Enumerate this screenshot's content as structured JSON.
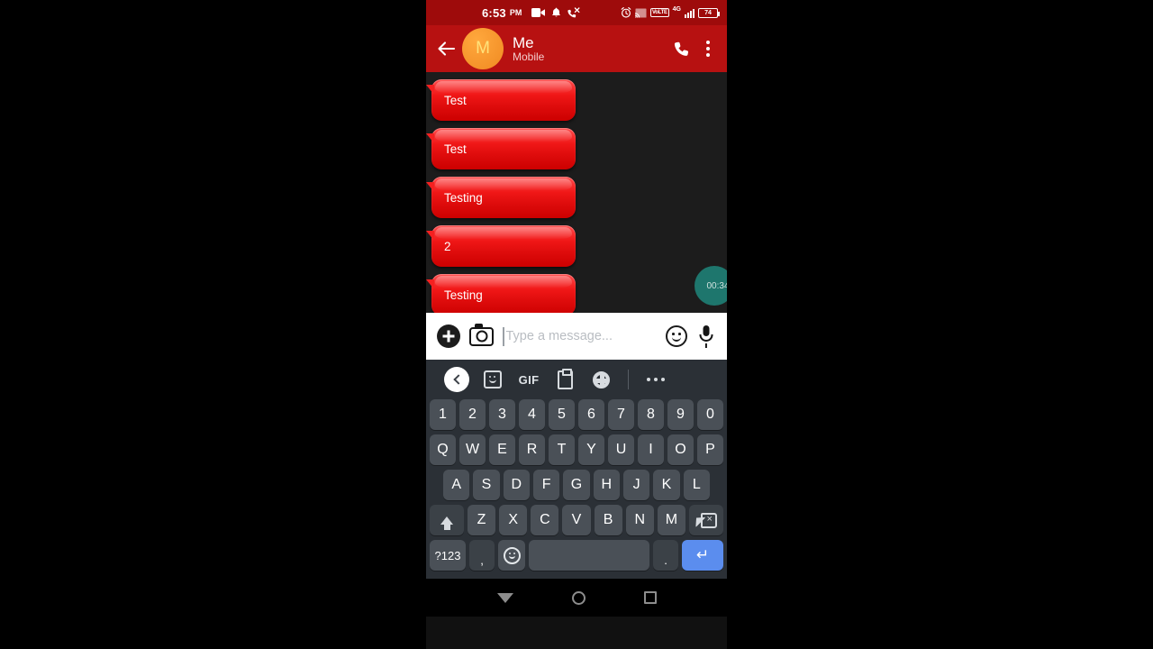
{
  "statusbar": {
    "time": "6:53",
    "ampm": "PM",
    "icons_left": [
      "video-recorder-icon",
      "bell-icon",
      "missed-call-icon"
    ],
    "alarm": "alarm-icon",
    "cast": "cast-icon",
    "volte": "VoLTE",
    "network": "4G",
    "battery_level": "74",
    "bg_color": "#9e0b0b"
  },
  "appbar": {
    "back_label": "back-arrow",
    "avatar_letter": "M",
    "contact_name": "Me",
    "contact_subtitle": "Mobile",
    "call_label": "call",
    "overflow_label": "more-options",
    "bg_color": "#b71111",
    "avatar_color": "#f08a22"
  },
  "chat": {
    "bg_color": "#1c1c1c",
    "bubble_color": "#e00d0d",
    "messages": [
      {
        "text": "Test"
      },
      {
        "text": "Test"
      },
      {
        "text": "Testing"
      },
      {
        "text": "2"
      },
      {
        "text": "Testing"
      }
    ],
    "recorder_timer": "00:34",
    "recorder_color": "#1f7e74"
  },
  "input_bar": {
    "attach_label": "add",
    "camera_label": "camera",
    "placeholder": "Type a message...",
    "value": "",
    "emoji_label": "emoji",
    "mic_label": "voice-input",
    "bg_color": "#ffffff"
  },
  "keyboard": {
    "bg_color": "#2b3036",
    "key_color": "#4a5057",
    "enter_color": "#5b8dee",
    "toolbar": [
      {
        "name": "expand-toolbar",
        "label": ""
      },
      {
        "name": "sticker",
        "label": ""
      },
      {
        "name": "gif",
        "label": "GIF"
      },
      {
        "name": "clipboard",
        "label": ""
      },
      {
        "name": "settings",
        "label": ""
      },
      {
        "name": "more",
        "label": ""
      }
    ],
    "rows": {
      "numbers": [
        "1",
        "2",
        "3",
        "4",
        "5",
        "6",
        "7",
        "8",
        "9",
        "0"
      ],
      "top": [
        "Q",
        "W",
        "E",
        "R",
        "T",
        "Y",
        "U",
        "I",
        "O",
        "P"
      ],
      "home": [
        "A",
        "S",
        "D",
        "F",
        "G",
        "H",
        "J",
        "K",
        "L"
      ],
      "bottom": [
        "Z",
        "X",
        "C",
        "V",
        "B",
        "N",
        "M"
      ]
    },
    "shift_label": "shift",
    "backspace_label": "backspace",
    "symbols_label": "?123",
    "comma_label": ",",
    "emoji_key_label": "emoji",
    "space_label": "",
    "period_label": ".",
    "enter_label": "↵"
  },
  "navbar": {
    "back": "nav-back",
    "home": "nav-home",
    "recents": "nav-recents"
  }
}
